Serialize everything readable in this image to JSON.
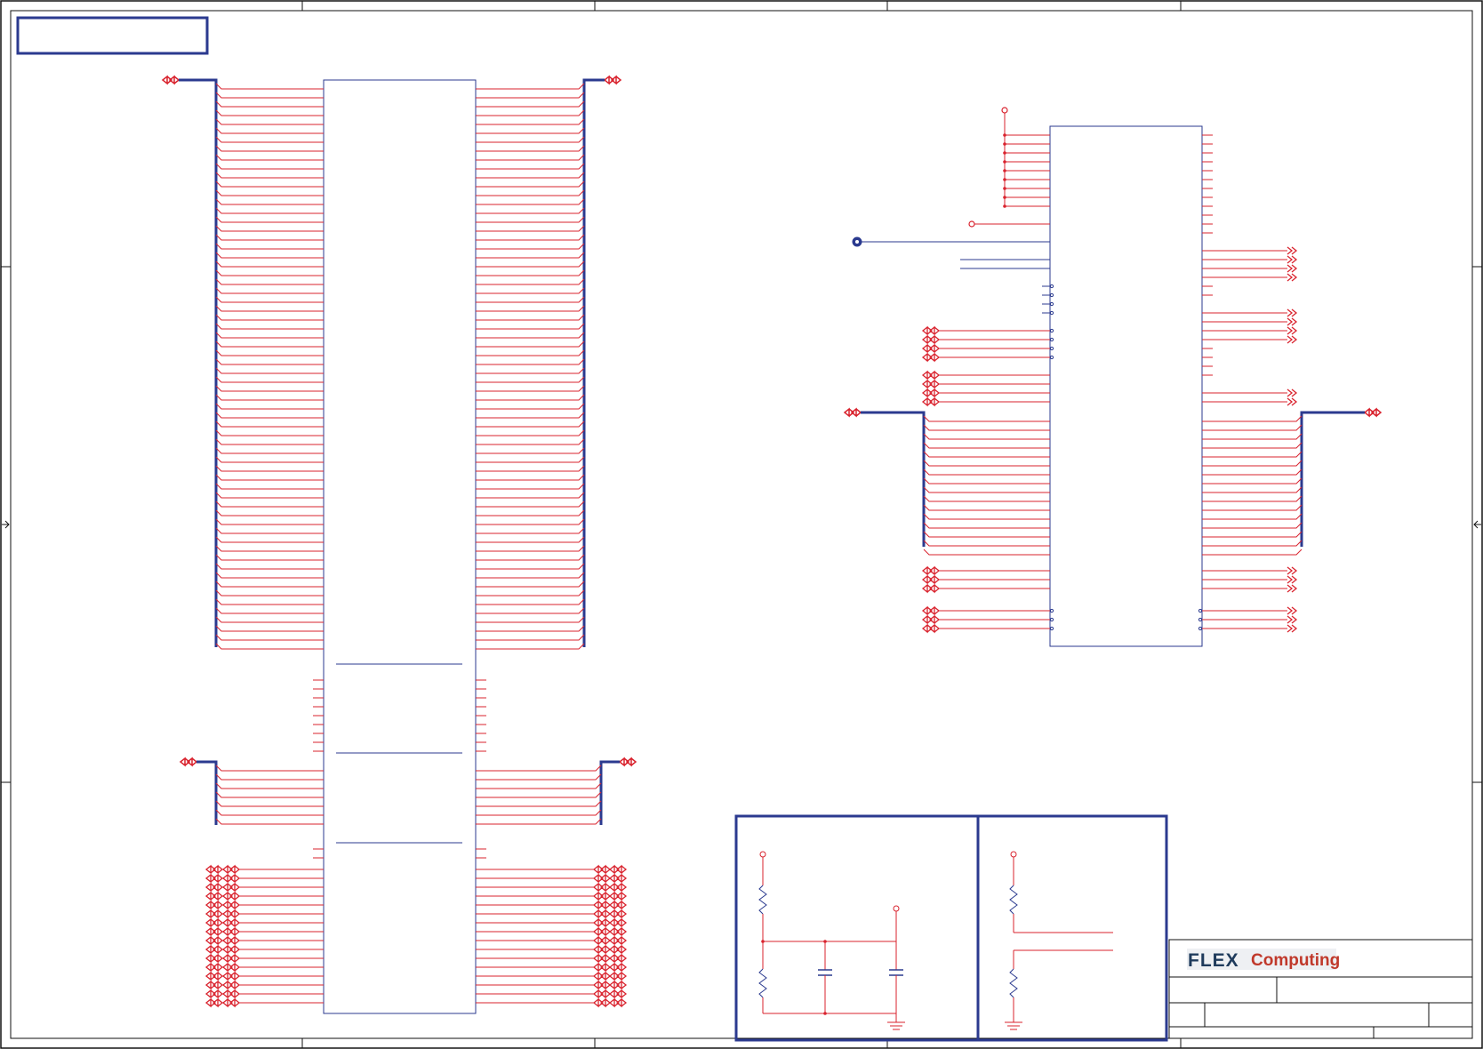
{
  "title_block": {
    "logo_part1": "FLEX",
    "logo_part2": "Computing"
  },
  "colors": {
    "wire": "#d9232e",
    "bus": "#2b3a8f",
    "border": "#2b3a8f",
    "frame": "#111111",
    "logo_dark": "#1f3b5c",
    "logo_red": "#c0392b"
  },
  "icons": [
    "port-connector-icon",
    "power-flag-icon",
    "ground-icon",
    "resistor-icon",
    "capacitor-icon",
    "test-point-icon"
  ]
}
